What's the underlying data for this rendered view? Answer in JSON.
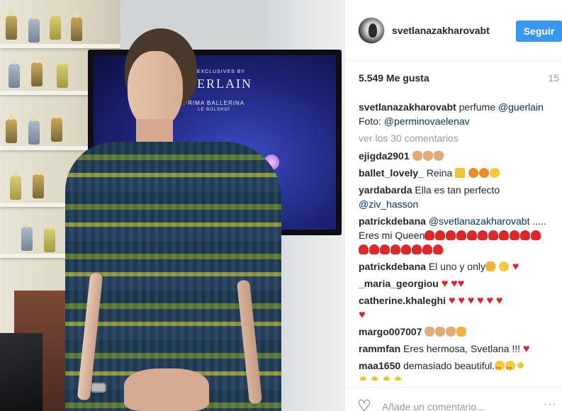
{
  "post": {
    "username": "svetlanazakharovabt",
    "follow_label": "Seguir",
    "likes": "5.549 Me gusta",
    "time": "15 ",
    "caption": {
      "username": "svetlanazakharovabt",
      "text": " perfume ",
      "tag1": "@guerlain",
      "line2": "Foto: ",
      "tag2": "@perminovaelenav"
    },
    "view_all": "ver los 30 comentarios"
  },
  "photo": {
    "tv_small": "THE EXCLUSIVES BY",
    "tv_brand": "GUERLAIN",
    "tv_sub": "PRIMA BALLERINA",
    "tv_sub2": "LE BOLSHOÏ"
  },
  "comments": [
    {
      "user": "ejigda2901",
      "text": ""
    },
    {
      "user": "ballet_lovely_",
      "text": "Reina "
    },
    {
      "user": "yardabarda",
      "text": "Ella es tan perfecto ",
      "tag": "@ziv_hasson"
    },
    {
      "user": "patrickdebana",
      "tag": "@svetlanazakharovabt",
      "text": " ..... Eres mi Queen"
    },
    {
      "user": "patrickdebana",
      "text": "El uno y only"
    },
    {
      "user": "_maria_georgiou",
      "text": ""
    },
    {
      "user": "catherine.khaleghi",
      "text": ""
    },
    {
      "user": "margo007007",
      "text": ""
    },
    {
      "user": "rammfan",
      "text": "Eres hermosa, Svetlana !!! "
    },
    {
      "user": "maa1650",
      "text": "demasiado beautiful."
    }
  ],
  "footer": {
    "placeholder": "Añade un comentario...",
    "options": "···"
  },
  "icons": {
    "heart": "heart-outline-icon",
    "options": "more-options-icon"
  },
  "colors": {
    "follow_button": "#3897f0",
    "tag_link": "#003569",
    "muted": "#999999"
  }
}
